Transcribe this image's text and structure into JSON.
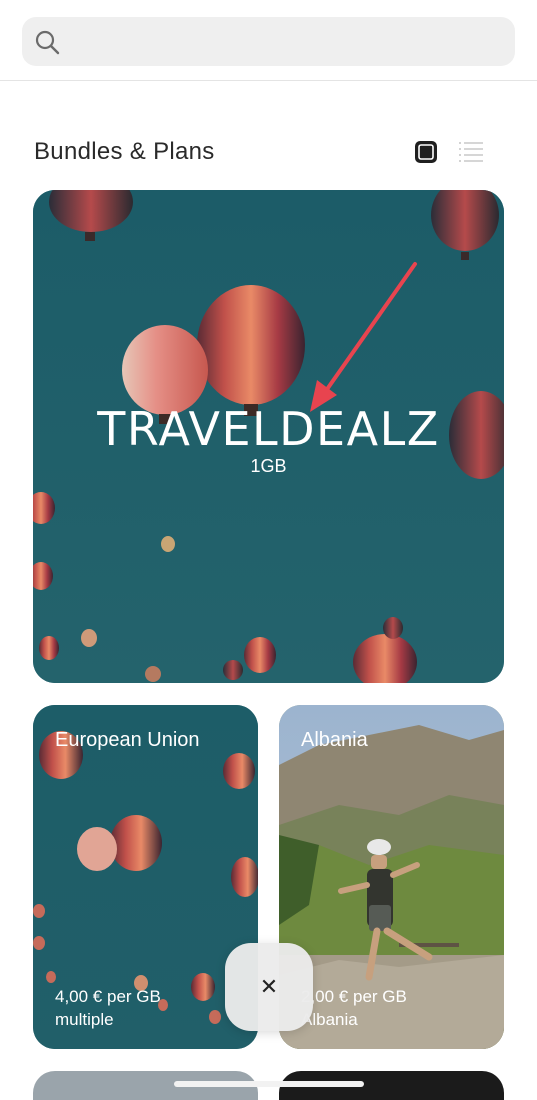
{
  "search": {
    "placeholder": "",
    "value": ""
  },
  "section": {
    "title": "Bundles & Plans"
  },
  "view_toggle": {
    "selected": "grid"
  },
  "hero_card": {
    "title": "TRAVELDEALZ",
    "subtitle": "1GB"
  },
  "cards": [
    {
      "name": "European Union",
      "price": "4,00 € per GB",
      "note": "multiple"
    },
    {
      "name": "Albania",
      "price": "2,00 € per GB",
      "note": "Albania"
    }
  ],
  "close_button": {
    "label": "✕"
  },
  "colors": {
    "hero_bg": "#1f5f6a",
    "annotation_arrow": "#e8444f",
    "search_bg": "#efefef"
  }
}
